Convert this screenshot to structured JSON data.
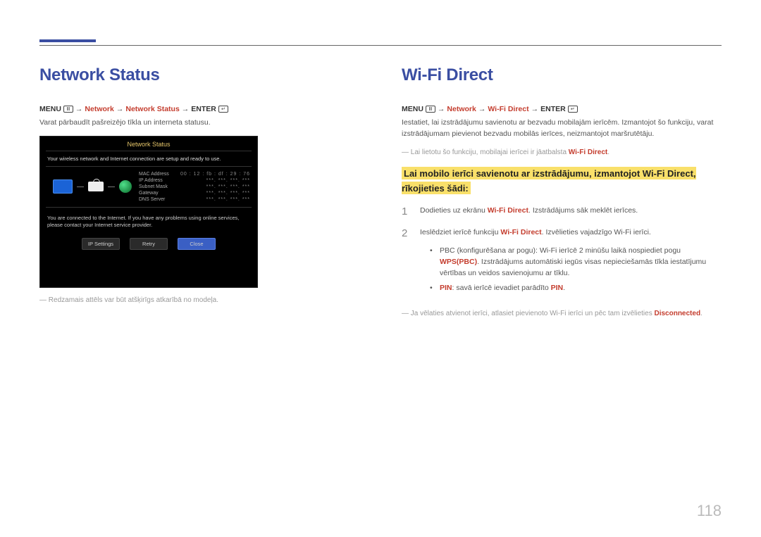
{
  "page_number": "118",
  "left": {
    "heading": "Network Status",
    "menu_label": "MENU",
    "path_seg1": "Network",
    "path_seg2": "Network Status",
    "enter_label": "ENTER",
    "desc": "Varat pārbaudīt pašreizējo tīkla un interneta statusu.",
    "footnote": "Redzamais attēls var būt atšķirīgs atkarībā no modeļa."
  },
  "screenshot": {
    "title": "Network Status",
    "msg_top": "Your wireless network and Internet connection are setup and ready to use.",
    "info": {
      "mac_label": "MAC Address",
      "mac_value": "00 : 12 : fb : df : 29 : 76",
      "ip_label": "IP Address",
      "mask_label": "Subnet Mask",
      "gw_label": "Gateway",
      "dns_label": "DNS Server",
      "masked": "***. ***. ***. ***"
    },
    "msg_bottom": "You are connected to the Internet. If you have any problems using online services, please contact your Internet service provider.",
    "buttons": {
      "ip": "IP Settings",
      "retry": "Retry",
      "close": "Close"
    }
  },
  "right": {
    "heading": "Wi-Fi Direct",
    "menu_label": "MENU",
    "path_seg1": "Network",
    "path_seg2": "Wi-Fi Direct",
    "enter_label": "ENTER",
    "desc": "Iestatiet, lai izstrādājumu savienotu ar bezvadu mobilajām ierīcēm. Izmantojot šo funkciju, varat izstrādājumam pievienot bezvadu mobilās ierīces, neizmantojot maršrutētāju.",
    "note1_pre": "Lai lietotu šo funkciju, mobilajai ierīcei ir jāatbalsta ",
    "note1_red": "Wi-Fi Direct",
    "highlight": "Lai mobilo ierīci savienotu ar izstrādājumu, izmantojot Wi-Fi Direct, rīkojieties šādi:",
    "step1_pre": "Dodieties uz ekrānu ",
    "step1_red": "Wi-Fi Direct",
    "step1_post": ". Izstrādājums sāk meklēt ierīces.",
    "step2_pre": "Ieslēdziet ierīcē funkciju ",
    "step2_red": "Wi-Fi Direct",
    "step2_post": ". Izvēlieties vajadzīgo Wi-Fi ierīci.",
    "bullet1_pre": "PBC (konfigurēšana ar pogu): Wi-Fi ierīcē 2 minūšu laikā nospiediet pogu ",
    "bullet1_red": "WPS(PBC)",
    "bullet1_post": ". Izstrādājums automātiski iegūs visas nepieciešamās tīkla iestatījumu vērtības un veidos savienojumu ar tīklu.",
    "bullet2_red1": "PIN",
    "bullet2_mid": ": savā ierīcē ievadiet parādīto ",
    "bullet2_red2": "PIN",
    "note2_pre": "Ja vēlaties atvienot ierīci, atlasiet pievienoto Wi-Fi ierīci un pēc tam izvēlieties ",
    "note2_red": "Disconnected"
  }
}
